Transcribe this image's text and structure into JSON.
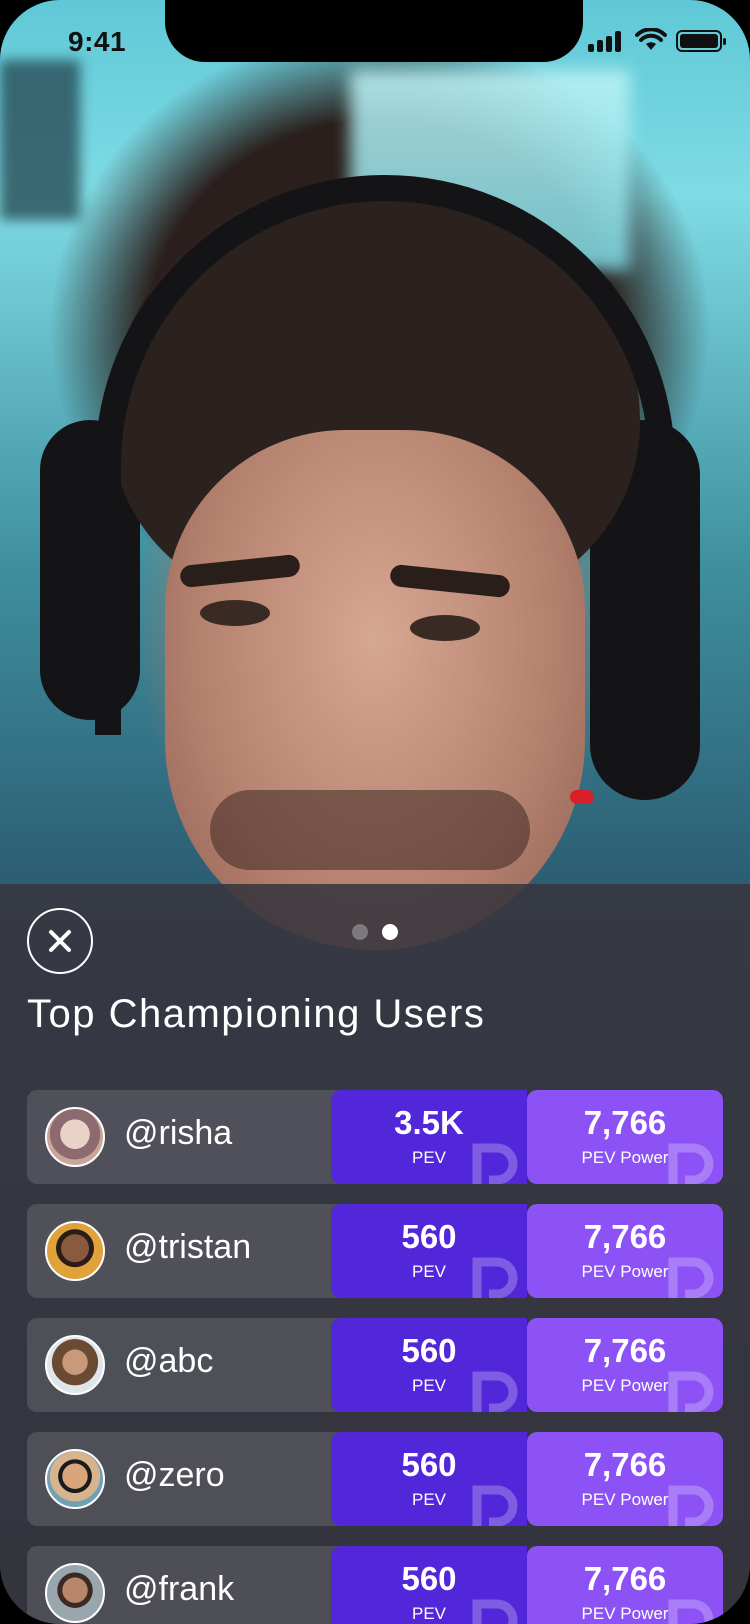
{
  "status_bar": {
    "time": "9:41"
  },
  "panel": {
    "title": "Top Championing Users",
    "page_dots": 2,
    "active_dot": 1
  },
  "users": [
    {
      "handle": "@risha",
      "pev": "3.5K",
      "pev_label": "PEV",
      "power": "7,766",
      "power_label": "PEV Power",
      "avatar_color": "#c8a79a"
    },
    {
      "handle": "@tristan",
      "pev": "560",
      "pev_label": "PEV",
      "power": "7,766",
      "power_label": "PEV Power",
      "avatar_color": "#e0a23a"
    },
    {
      "handle": "@abc",
      "pev": "560",
      "pev_label": "PEV",
      "power": "7,766",
      "power_label": "PEV Power",
      "avatar_color": "#b98a6c"
    },
    {
      "handle": "@zero",
      "pev": "560",
      "pev_label": "PEV",
      "power": "7,766",
      "power_label": "PEV Power",
      "avatar_color": "#d7b48e"
    },
    {
      "handle": "@frank",
      "pev": "560",
      "pev_label": "PEV",
      "power": "7,766",
      "power_label": "PEV Power",
      "avatar_color": "#9aa6ad"
    }
  ],
  "colors": {
    "pev": "#5227d9",
    "power": "#8c52f5"
  },
  "icons": [
    "close-icon",
    "signal-icon",
    "wifi-icon",
    "battery-icon",
    "pev-logo-icon"
  ]
}
